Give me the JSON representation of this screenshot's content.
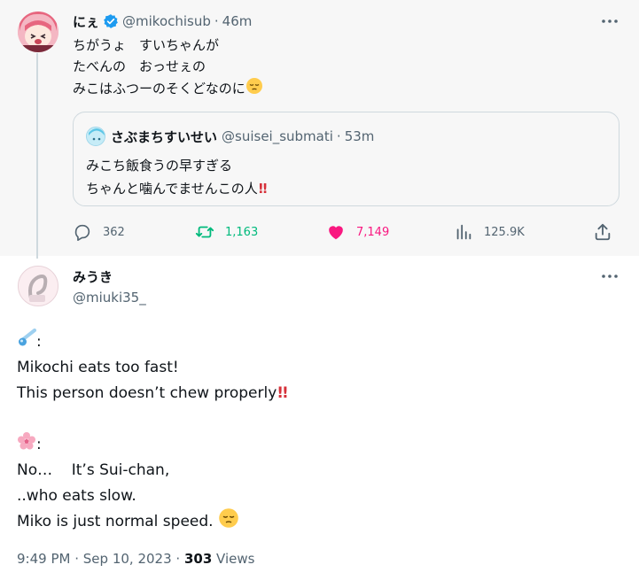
{
  "parent_tweet": {
    "name": "にぇ",
    "handle": "@mikochisub",
    "time": "46m",
    "text_lines": [
      "ちがうょ　すいちゃんが",
      "たべんの　おっせぇの",
      "みこはふつーのそくどなのに"
    ],
    "quote": {
      "name": "さぶまちすいせい",
      "handle": "@suisei_submati",
      "time": "53m",
      "text_lines": [
        "みこち飯食うの早すぎる",
        "ちゃんと噛んでませんこの人"
      ]
    },
    "stats": {
      "replies": "362",
      "retweets": "1,163",
      "likes": "7,149",
      "views": "125.9K"
    }
  },
  "main_tweet": {
    "name": "みうき",
    "handle": "@miuki35_",
    "lines": {
      "l1": ":",
      "l2": "Mikochi eats too fast!",
      "l3": "This person doesn’t chew properly",
      "l5": ":",
      "l6": "No…    It’s Sui-chan,",
      "l7": "..who eats slow.",
      "l8": "Miko is just normal speed. "
    },
    "meta": {
      "time": "9:49 PM",
      "date": "Sep 10, 2023",
      "views_count": "303",
      "views_label": "Views"
    }
  },
  "colors": {
    "retweet": "#00ba7c",
    "like": "#f91880",
    "verified": "#1d9bf0",
    "text": "#0f1419",
    "secondary": "#536471"
  }
}
